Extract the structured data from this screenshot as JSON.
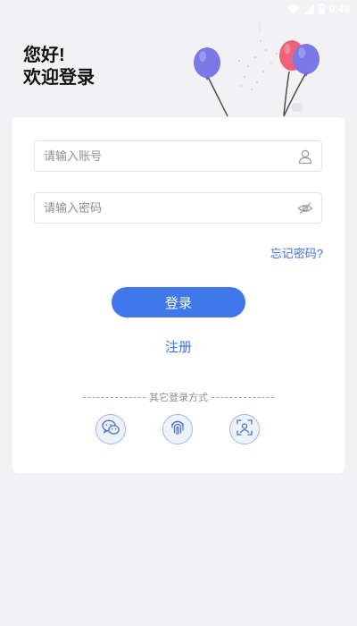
{
  "status_bar": {
    "time": "9:48",
    "icons": [
      "wifi-icon",
      "signal-icon",
      "battery-icon"
    ]
  },
  "greeting": {
    "line1": "您好!",
    "line2": "欢迎登录"
  },
  "login_form": {
    "account_placeholder": "请输入账号",
    "account_value": "",
    "account_icon": "user-icon",
    "password_placeholder": "请输入密码",
    "password_value": "",
    "password_icon": "eye-hidden-icon",
    "forgot_password": "忘记密码?",
    "login_button": "登录",
    "register_link": "注册"
  },
  "other_login": {
    "label": "其它登录方式",
    "methods": [
      "wechat-icon",
      "fingerprint-icon",
      "face-id-icon"
    ]
  },
  "colors": {
    "accent": "#4078ec",
    "link": "#3f6fd8",
    "background": "#f2f2f4",
    "card": "#ffffff",
    "balloon_purple": "#7a79e6",
    "balloon_pink": "#f0627c"
  }
}
